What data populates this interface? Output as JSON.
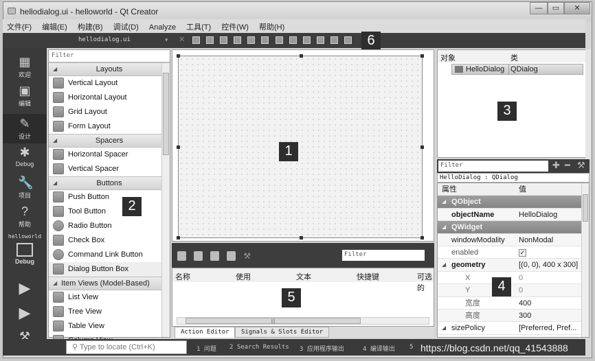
{
  "window": {
    "title": "hellodialog.ui - helloworld - Qt Creator",
    "controls": {
      "minimize": "—",
      "maximize": "▭",
      "close": "✕"
    }
  },
  "menubar": [
    "文件(F)",
    "编辑(E)",
    "构建(B)",
    "调试(D)",
    "Analyze",
    "工具(T)",
    "控件(W)",
    "帮助(H)"
  ],
  "editor_bar": {
    "filename": "hellodialog.ui",
    "tools": [
      "edit-widgets",
      "edit-signals-slots",
      "edit-buddies",
      "edit-tab-order",
      "layout-horizontal",
      "layout-vertical",
      "layout-horizontal-splitter",
      "layout-vertical-splitter",
      "layout-grid",
      "layout-form",
      "break-layout",
      "adjust-size"
    ]
  },
  "mode_sidebar": {
    "items": [
      {
        "label": "欢迎",
        "icon": "grid-icon"
      },
      {
        "label": "编辑",
        "icon": "edit-icon"
      },
      {
        "label": "设计",
        "icon": "pencil-icon"
      },
      {
        "label": "Debug",
        "icon": "bug-icon"
      },
      {
        "label": "项目",
        "icon": "wrench-icon"
      },
      {
        "label": "帮助",
        "icon": "help-icon"
      }
    ],
    "kit_project": "helloworld",
    "kit_build": "Debug",
    "run_actions": [
      "run-icon",
      "debug-run-icon",
      "build-icon"
    ]
  },
  "widget_box": {
    "filter_placeholder": "Filter",
    "categories": [
      {
        "name": "Layouts",
        "items": [
          "Vertical Layout",
          "Horizontal Layout",
          "Grid Layout",
          "Form Layout"
        ]
      },
      {
        "name": "Spacers",
        "items": [
          "Horizontal Spacer",
          "Vertical Spacer"
        ]
      },
      {
        "name": "Buttons",
        "items": [
          "Push Button",
          "Tool Button",
          "Radio Button",
          "Check Box",
          "Command Link Button",
          "Dialog Button Box"
        ]
      },
      {
        "name": "Item Views (Model-Based)",
        "items": [
          "List View",
          "Tree View",
          "Table View",
          "Column View"
        ]
      }
    ]
  },
  "locator": {
    "placeholder": "Type to locate (Ctrl+K)"
  },
  "action_editor": {
    "filter_placeholder": "Filter",
    "columns": [
      "名称",
      "使用",
      "文本",
      "快捷键",
      "可选的"
    ],
    "tabs": [
      "Action Editor",
      "Signals & Slots Editor"
    ],
    "active_tab": "Action Editor"
  },
  "object_inspector": {
    "columns": [
      "对象",
      "类"
    ],
    "rows": [
      {
        "object": "HelloDialog",
        "class": "QDialog"
      }
    ]
  },
  "property_editor": {
    "filter_placeholder": "Filter",
    "class_label": "HelloDialog : QDialog",
    "columns": [
      "属性",
      "值"
    ],
    "rows": [
      {
        "type": "group",
        "name": "QObject"
      },
      {
        "type": "prop",
        "name": "objectName",
        "value": "HelloDialog",
        "bold": true
      },
      {
        "type": "group",
        "name": "QWidget"
      },
      {
        "type": "prop",
        "name": "windowModality",
        "value": "NonModal"
      },
      {
        "type": "prop",
        "name": "enabled",
        "value": "✓"
      },
      {
        "type": "prop",
        "name": "geometry",
        "value": "[(0, 0), 400 x 300]",
        "bold": true,
        "expanded": true
      },
      {
        "type": "sub",
        "name": "X",
        "value": "0"
      },
      {
        "type": "sub",
        "name": "Y",
        "value": "0"
      },
      {
        "type": "sub",
        "name": "宽度",
        "value": "400"
      },
      {
        "type": "sub",
        "name": "高度",
        "value": "300"
      },
      {
        "type": "prop",
        "name": "sizePolicy",
        "value": "[Preferred, Pref...",
        "collapsed": true
      }
    ]
  },
  "output_panes": [
    "1 问题",
    "2 Search Results",
    "3 应用程序输出",
    "4 编译输出",
    "5"
  ],
  "annotations": [
    "1",
    "2",
    "3",
    "4",
    "5",
    "6"
  ],
  "watermark": "https://blog.csdn.net/qq_41543888"
}
